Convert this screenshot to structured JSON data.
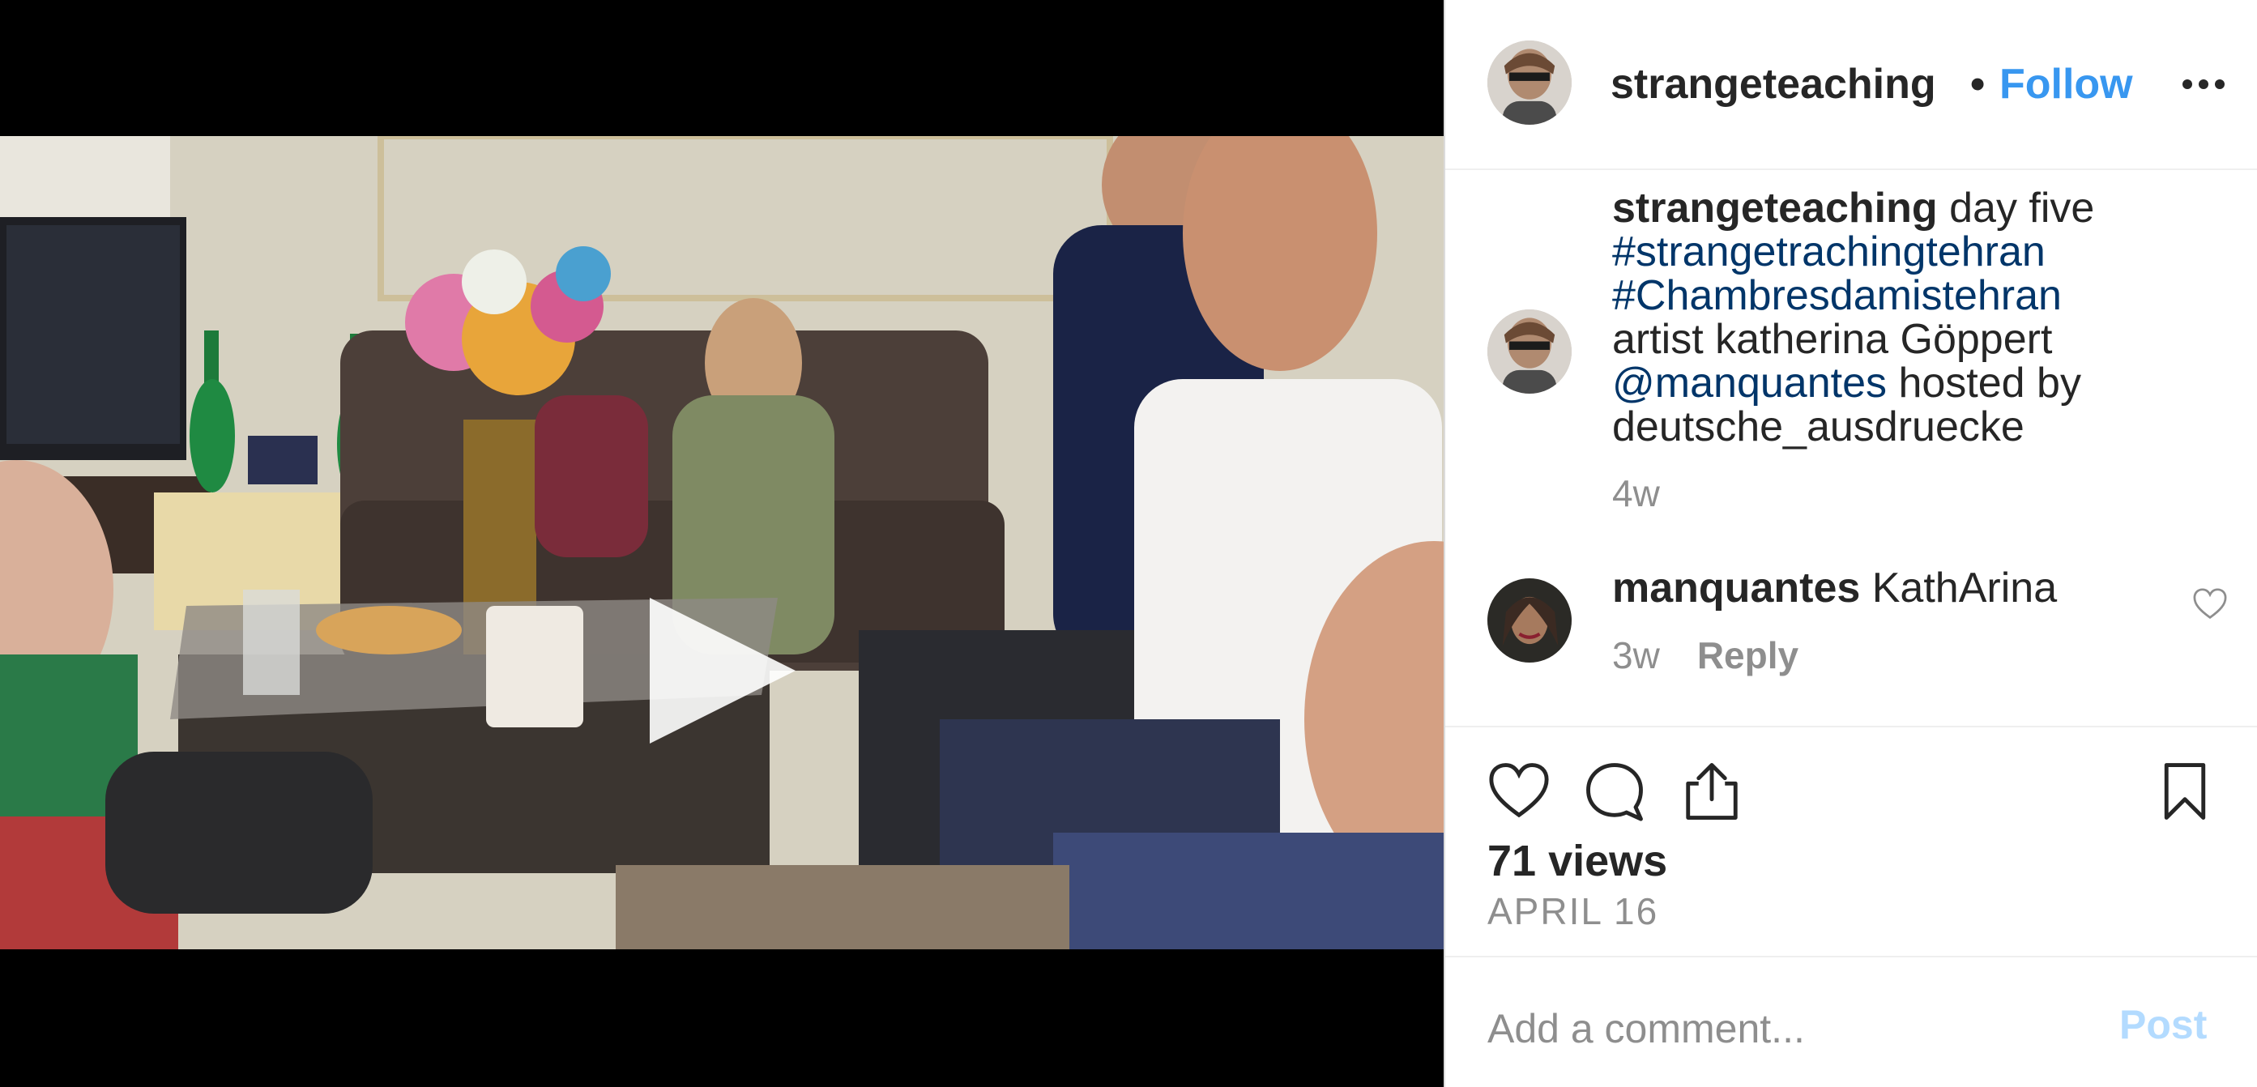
{
  "post": {
    "username": "strangeteaching",
    "separator": "•",
    "follow_label": "Follow",
    "more_icon": "more-horizontal-icon"
  },
  "caption": {
    "username": "strangeteaching",
    "text_start": " day five",
    "hashtag_1": "#strangetrachingtehran",
    "hashtag_2": "#Chambresdamistehran",
    "line_artist": "artist katherina Göppert",
    "mention": "@manquantes",
    "text_hosted": " hosted by",
    "line_host": "deutsche_ausdruecke",
    "time": "4w"
  },
  "comment": {
    "username": "manquantes",
    "text": " KathArina",
    "time": "3w",
    "reply_label": "Reply",
    "like_icon": "heart-outline-icon"
  },
  "actions": {
    "like_icon": "heart-outline-icon",
    "comment_icon": "comment-bubble-icon",
    "share_icon": "share-upload-icon",
    "save_icon": "bookmark-outline-icon"
  },
  "stats": {
    "views": "71 views",
    "date": "APRIL 16"
  },
  "add_comment": {
    "placeholder": "Add a comment...",
    "post_label": "Post"
  },
  "colors": {
    "follow": "#3897f0",
    "hashtag": "#003569",
    "post_disabled": "#b3dbff",
    "muted": "#8e8e8e"
  }
}
